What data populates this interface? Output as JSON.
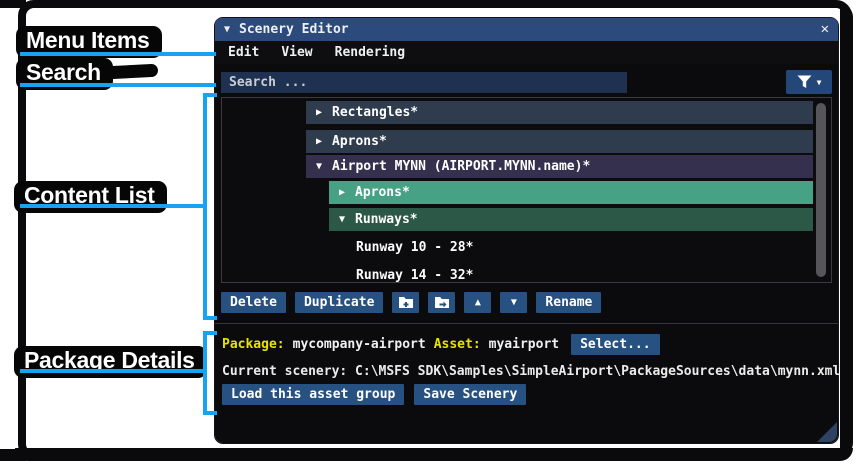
{
  "colors": {
    "accent": "#18a2f2",
    "titlebar": "#2c4a7c",
    "button": "#275181",
    "slate_row": "#2e3c4e",
    "purple_row": "#35304d",
    "green_group": "#47a184",
    "dark_green_group": "#2c5847",
    "label_yellow": "#e8e300"
  },
  "annotations": {
    "menu_items": "Menu Items",
    "search": "Search",
    "content_list": "Content List",
    "package_details": "Package Details"
  },
  "window": {
    "title": "Scenery Editor",
    "collapse_icon": "▼",
    "close_icon": "✕",
    "menu": {
      "items": [
        "Edit",
        "View",
        "Rendering"
      ]
    },
    "search": {
      "placeholder": "Search ..."
    },
    "filter": {
      "caret": "▼"
    },
    "tree": {
      "rows": [
        {
          "arrow": "▶",
          "label": "Rectangles*"
        },
        {
          "arrow": "▶",
          "label": "Aprons*"
        },
        {
          "arrow": "▼",
          "label": "Airport MYNN (AIRPORT.MYNN.name)*"
        },
        {
          "arrow": "▶",
          "label": "Aprons*"
        },
        {
          "arrow": "▼",
          "label": "Runways*"
        },
        {
          "label": "Runway 10 - 28*"
        },
        {
          "label": "Runway 14 - 32*"
        }
      ]
    },
    "toolbar": {
      "delete": "Delete",
      "duplicate": "Duplicate",
      "move_up": "▲",
      "move_down": "▼",
      "rename": "Rename"
    },
    "package": {
      "package_label": "Package:",
      "package_value": "mycompany-airport",
      "asset_label": "Asset:",
      "asset_value": "myairport",
      "select_button": "Select...",
      "current_scenery": "Current scenery: C:\\MSFS SDK\\Samples\\SimpleAirport\\PackageSources\\data\\mynn.xml",
      "load_button": "Load this asset group",
      "save_button": "Save Scenery"
    }
  }
}
